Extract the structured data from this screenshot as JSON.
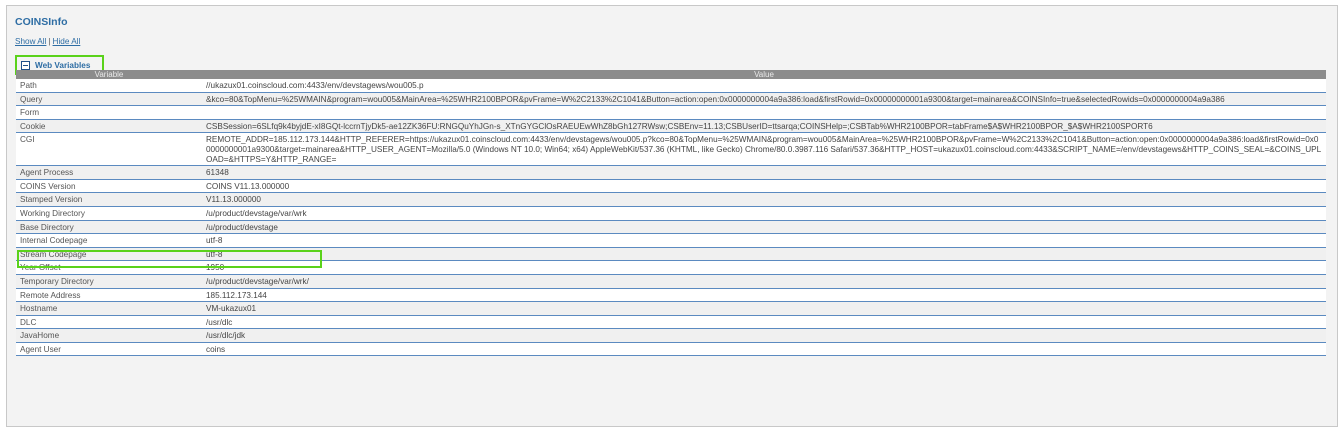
{
  "title": "COINSInfo",
  "links": {
    "show_all": "Show All",
    "separator": "|",
    "hide_all": "Hide All"
  },
  "section": {
    "label": "Web Variables",
    "toggle_icon": "minus-box-icon"
  },
  "table": {
    "headers": [
      "Variable",
      "Value"
    ],
    "rows": [
      {
        "name": "Path",
        "value": "//ukazux01.coinscloud.com:4433/env/devstagews/wou005.p"
      },
      {
        "name": "Query",
        "value": "&kco=80&TopMenu=%25WMAIN&program=wou005&MainArea=%25WHR2100BPOR&pvFrame=W%2C2133%2C1041&Button=action:open:0x0000000004a9a386:load&firstRowid=0x00000000001a9300&target=mainarea&COINSInfo=true&selectedRowids=0x0000000004a9a386"
      },
      {
        "name": "Form",
        "value": ""
      },
      {
        "name": "Cookie",
        "value": "CSBSession=6SLfq9k4byjdE-xI8GQt-lccrnTjyDk5-ae12ZK36FU:RNGQuYhJGn-s_XTnGYGClOsRAEUEwWhZ8bGh127RWsw;CSBEnv=11.13;CSBUserID=ttsarqa;COINSHelp=;CSBTab%WHR2100BPOR=tabFrame$A$WHR2100BPOR_$A$WHR2100SPORT6"
      },
      {
        "name": "CGI",
        "value": "REMOTE_ADDR=185.112.173.144&HTTP_REFERER=https://ukazux01.coinscloud.com:4433/env/devstagews/wou005.p?kco=80&TopMenu=%25WMAIN&program=wou005&MainArea=%25WHR2100BPOR&pvFrame=W%2C2133%2C1041&Button=action:open:0x0000000004a9a386:load&firstRowid=0x00000000001a9300&target=mainarea&HTTP_USER_AGENT=Mozilla/5.0 (Windows NT 10.0; Win64; x64) AppleWebKit/537.36 (KHTML, like Gecko) Chrome/80.0.3987.116 Safari/537.36&HTTP_HOST=ukazux01.coinscloud.com:4433&SCRIPT_NAME=/env/devstagews&HTTP_COINS_SEAL=&COINS_UPLOAD=&HTTPS=Y&HTTP_RANGE="
      },
      {
        "name": "Agent Process",
        "value": "61348"
      },
      {
        "name": "COINS Version",
        "value": "COINS V11.13.000000"
      },
      {
        "name": "Stamped Version",
        "value": "V11.13.000000"
      },
      {
        "name": "Working Directory",
        "value": "/u/product/devstage/var/wrk"
      },
      {
        "name": "Base Directory",
        "value": "/u/product/devstage"
      },
      {
        "name": "Internal Codepage",
        "value": "utf-8"
      },
      {
        "name": "Stream Codepage",
        "value": "utf-8"
      },
      {
        "name": "Year Offset",
        "value": "1950"
      },
      {
        "name": "Temporary Directory",
        "value": "/u/product/devstage/var/wrk/"
      },
      {
        "name": "Remote Address",
        "value": "185.112.173.144"
      },
      {
        "name": "Hostname",
        "value": "VM-ukazux01"
      },
      {
        "name": "DLC",
        "value": "/usr/dlc"
      },
      {
        "name": "JavaHome",
        "value": "/usr/dlc/jdk"
      },
      {
        "name": "Agent User",
        "value": "coins"
      }
    ]
  },
  "colors": {
    "link": "#2e6da4",
    "highlight": "#5ad21a",
    "header_bg": "#8c8c8c",
    "row_border": "#5b8ac0"
  }
}
